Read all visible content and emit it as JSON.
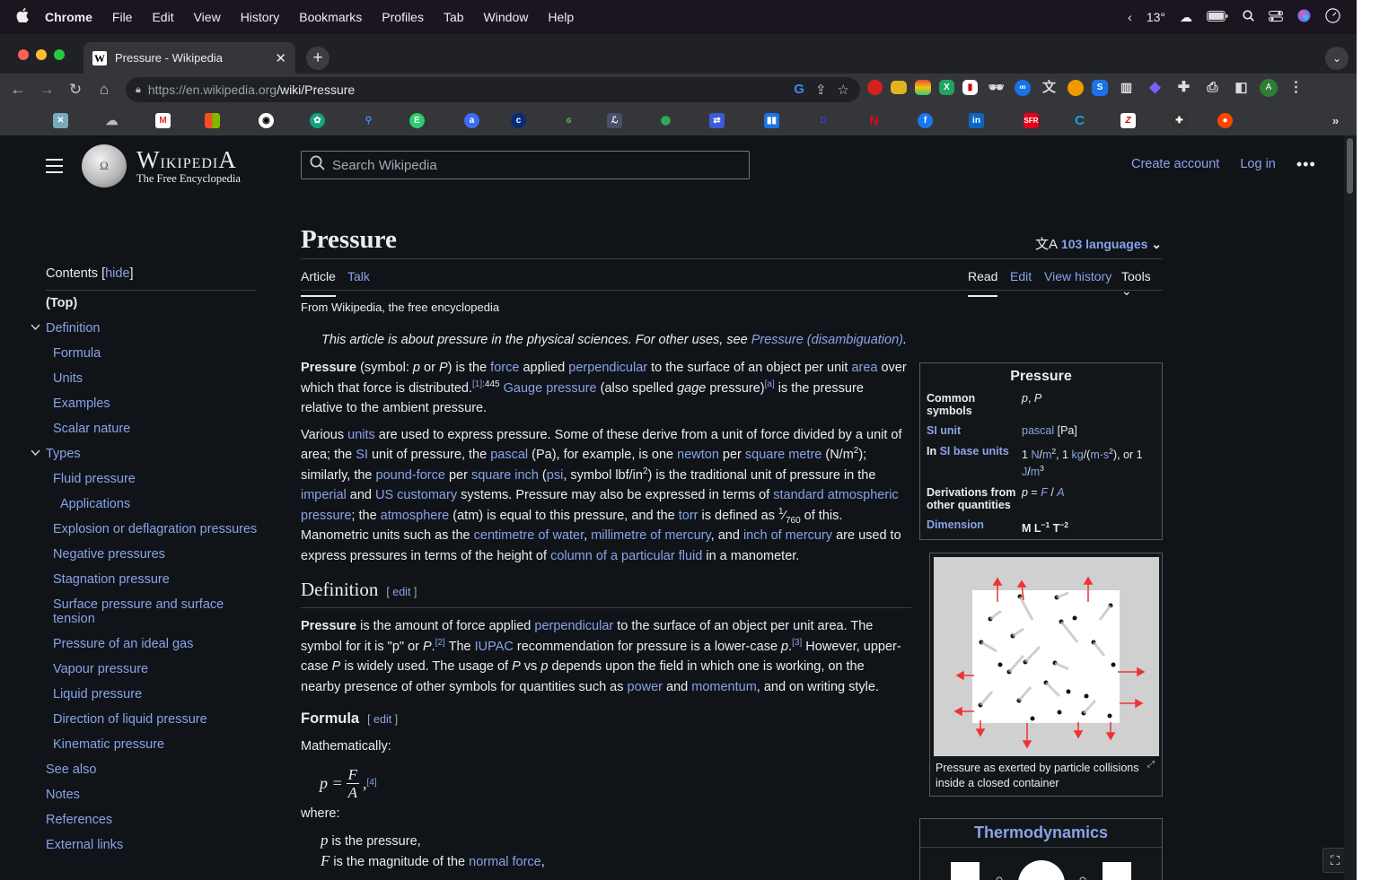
{
  "menubar": {
    "app": "Chrome",
    "items": [
      "File",
      "Edit",
      "View",
      "History",
      "Bookmarks",
      "Profiles",
      "Tab",
      "Window",
      "Help"
    ],
    "weather": "13°"
  },
  "tab": {
    "title": "Pressure - Wikipedia"
  },
  "omnibox": {
    "url_host": "https://en.wikipedia.org",
    "url_path": "/wiki/Pressure"
  },
  "profile_letter": "A",
  "header": {
    "wordmark": "Wikipedia",
    "tagline": "The Free Encyclopedia",
    "search_placeholder": "Search Wikipedia",
    "create_account": "Create account",
    "log_in": "Log in"
  },
  "toc": {
    "title": "Contents",
    "hide": "hide",
    "items": [
      "(Top)",
      "Definition",
      "Formula",
      "Units",
      "Examples",
      "Scalar nature",
      "Types",
      "Fluid pressure",
      "Applications",
      "Explosion or deflagration pressures",
      "Negative pressures",
      "Stagnation pressure",
      "Surface pressure and surface tension",
      "Pressure of an ideal gas",
      "Vapour pressure",
      "Liquid pressure",
      "Direction of liquid pressure",
      "Kinematic pressure",
      "See also",
      "Notes",
      "References",
      "External links"
    ]
  },
  "article": {
    "title": "Pressure",
    "languages": "103 languages",
    "tabs": {
      "article": "Article",
      "talk": "Talk",
      "read": "Read",
      "edit": "Edit",
      "history": "View history",
      "tools": "Tools"
    },
    "tagline": "From Wikipedia, the free encyclopedia",
    "hatnote_text": "This article is about pressure in the physical sciences. For other uses, see ",
    "hatnote_link": "Pressure (disambiguation)",
    "definition_heading": "Definition",
    "formula_heading": "Formula",
    "edit_label": "edit",
    "mathematically": "Mathematically:",
    "where": "where:"
  },
  "infobox": {
    "caption": "Pressure",
    "rows": [
      {
        "label": "Common symbols",
        "value": "p, P"
      },
      {
        "label": "SI unit",
        "value": "pascal [Pa]"
      },
      {
        "label": "In SI base units",
        "value": "1 N/m2, 1 kg/(m·s2), or 1 J/m3"
      },
      {
        "label": "Derivations from other quantities",
        "value": "p = F / A"
      },
      {
        "label": "Dimension",
        "value": "M L−1 T−2"
      }
    ]
  },
  "figure": {
    "caption": "Pressure as exerted by particle collisions inside a closed container"
  },
  "navbox": {
    "title": "Thermodynamics"
  }
}
